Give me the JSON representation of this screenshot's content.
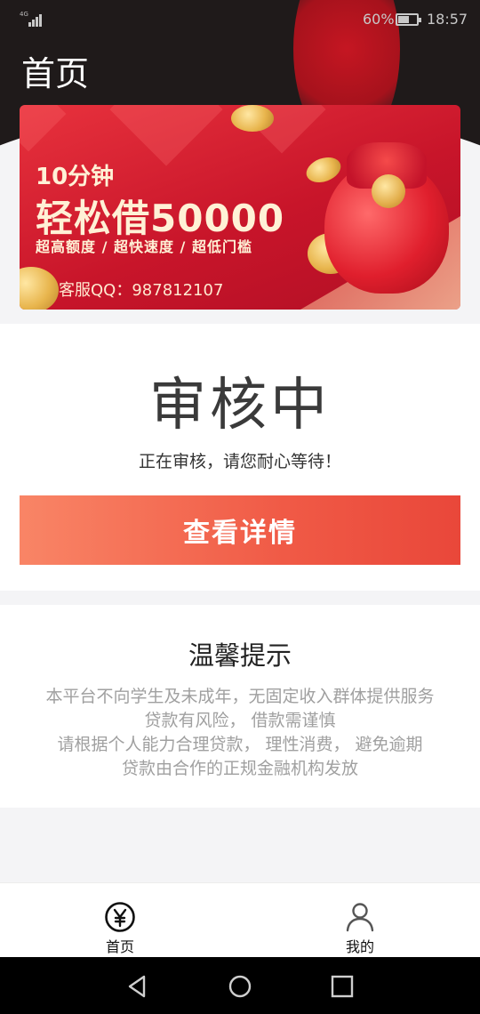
{
  "status_bar": {
    "network": "4G",
    "battery": "60%",
    "battery_level": 0.6,
    "time": "18:57"
  },
  "header": {
    "title": "首页"
  },
  "banner": {
    "line1": "10分钟",
    "line2": "轻松借50000",
    "line3": "超高额度 / 超快速度 / 超低门槛",
    "contact": "客服QQ：987812107"
  },
  "review": {
    "status": "审核中",
    "message": "正在审核，请您耐心等待！",
    "detail_button": "查看详情"
  },
  "tips": {
    "title": "温馨提示",
    "lines": [
      "本平台不向学生及未成年，无固定收入群体提供服务",
      "贷款有风险， 借款需谨慎",
      "请根据个人能力合理贷款， 理性消费， 避免逾期",
      "贷款由合作的正规金融机构发放"
    ]
  },
  "tabbar": {
    "items": [
      {
        "label": "首页",
        "icon": "yen-circle-icon"
      },
      {
        "label": "我的",
        "icon": "person-icon"
      }
    ]
  },
  "colors": {
    "accent": "#f05a46",
    "header_bg": "#1f1a1a",
    "banner_red": "#c8152a"
  }
}
